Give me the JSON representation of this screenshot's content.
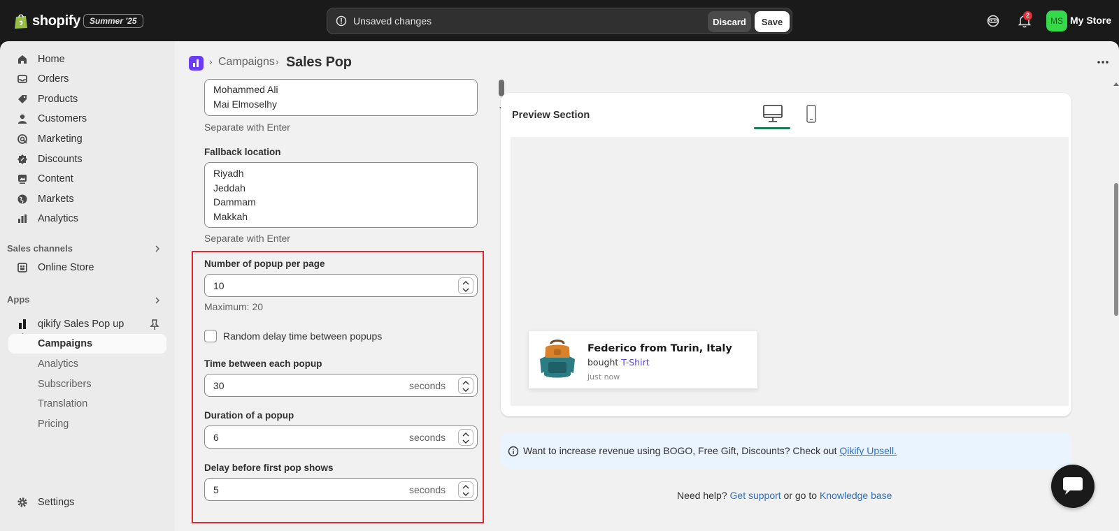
{
  "topbar": {
    "brand": "shopify",
    "edition": "Summer '25",
    "unsaved_text": "Unsaved changes",
    "discard_label": "Discard",
    "save_label": "Save",
    "notification_count": "2",
    "avatar_initials": "MS",
    "store_name": "My Store"
  },
  "sidebar": {
    "items": [
      {
        "label": "Home",
        "icon": "home-icon"
      },
      {
        "label": "Orders",
        "icon": "orders-icon"
      },
      {
        "label": "Products",
        "icon": "tag-icon"
      },
      {
        "label": "Customers",
        "icon": "person-icon"
      },
      {
        "label": "Marketing",
        "icon": "target-icon"
      },
      {
        "label": "Discounts",
        "icon": "discount-icon"
      },
      {
        "label": "Content",
        "icon": "content-icon"
      },
      {
        "label": "Markets",
        "icon": "globe-icon"
      },
      {
        "label": "Analytics",
        "icon": "bar-chart-icon"
      }
    ],
    "sales_channels_label": "Sales channels",
    "online_store_label": "Online Store",
    "apps_label": "Apps",
    "app_name": "qikify Sales Pop up",
    "app_subitems": [
      "Campaigns",
      "Analytics",
      "Subscribers",
      "Translation",
      "Pricing"
    ],
    "settings_label": "Settings"
  },
  "breadcrumb": {
    "parent": "Campaigns",
    "current": "Sales Pop"
  },
  "settings": {
    "names_lines": [
      "Mohammed Ali",
      "Mai Elmoselhy"
    ],
    "names_help": "Separate with Enter",
    "fallback_location_label": "Fallback location",
    "fallback_locations": [
      "Riyadh",
      "Jeddah",
      "Dammam",
      "Makkah"
    ],
    "fallback_help": "Separate with Enter",
    "popups_per_page_label": "Number of popup per page",
    "popups_per_page_value": "10",
    "popups_per_page_help": "Maximum: 20",
    "random_delay_label": "Random delay time between popups",
    "random_delay_checked": false,
    "time_between_label": "Time between each popup",
    "time_between_value": "30",
    "duration_label": "Duration of a popup",
    "duration_value": "6",
    "first_delay_label": "Delay before first pop shows",
    "first_delay_value": "5",
    "seconds_suffix": "seconds"
  },
  "preview": {
    "title": "Preview Section",
    "popup": {
      "customer": "Federico from Turin, Italy",
      "bought_prefix": "bought ",
      "product": "T-Shirt",
      "time": "just now"
    }
  },
  "banner": {
    "text": "Want to increase revenue using BOGO, Free Gift, Discounts? Check out ",
    "link": "Qikify Upsell."
  },
  "help": {
    "prefix": "Need help? ",
    "support_link": "Get support",
    "middle": " or go to ",
    "kb_link": "Knowledge base"
  },
  "colors": {
    "accent_green": "#1d7a57",
    "highlight_red": "#e5282f",
    "link_blue": "#2c6ecb",
    "app_purple": "#6b3cf5"
  }
}
